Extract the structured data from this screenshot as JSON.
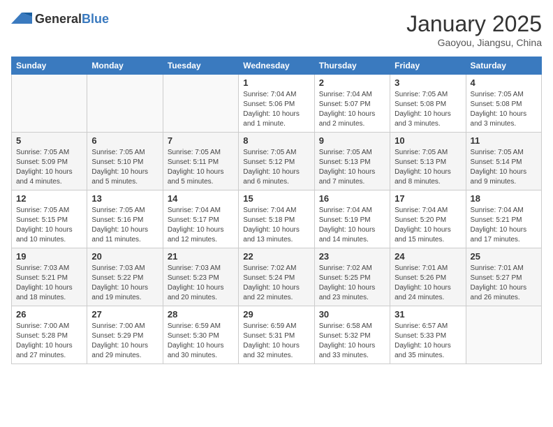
{
  "header": {
    "logo_general": "General",
    "logo_blue": "Blue",
    "title": "January 2025",
    "subtitle": "Gaoyou, Jiangsu, China"
  },
  "weekdays": [
    "Sunday",
    "Monday",
    "Tuesday",
    "Wednesday",
    "Thursday",
    "Friday",
    "Saturday"
  ],
  "weeks": [
    [
      {
        "day": "",
        "info": ""
      },
      {
        "day": "",
        "info": ""
      },
      {
        "day": "",
        "info": ""
      },
      {
        "day": "1",
        "info": "Sunrise: 7:04 AM\nSunset: 5:06 PM\nDaylight: 10 hours\nand 1 minute."
      },
      {
        "day": "2",
        "info": "Sunrise: 7:04 AM\nSunset: 5:07 PM\nDaylight: 10 hours\nand 2 minutes."
      },
      {
        "day": "3",
        "info": "Sunrise: 7:05 AM\nSunset: 5:08 PM\nDaylight: 10 hours\nand 3 minutes."
      },
      {
        "day": "4",
        "info": "Sunrise: 7:05 AM\nSunset: 5:08 PM\nDaylight: 10 hours\nand 3 minutes."
      }
    ],
    [
      {
        "day": "5",
        "info": "Sunrise: 7:05 AM\nSunset: 5:09 PM\nDaylight: 10 hours\nand 4 minutes."
      },
      {
        "day": "6",
        "info": "Sunrise: 7:05 AM\nSunset: 5:10 PM\nDaylight: 10 hours\nand 5 minutes."
      },
      {
        "day": "7",
        "info": "Sunrise: 7:05 AM\nSunset: 5:11 PM\nDaylight: 10 hours\nand 5 minutes."
      },
      {
        "day": "8",
        "info": "Sunrise: 7:05 AM\nSunset: 5:12 PM\nDaylight: 10 hours\nand 6 minutes."
      },
      {
        "day": "9",
        "info": "Sunrise: 7:05 AM\nSunset: 5:13 PM\nDaylight: 10 hours\nand 7 minutes."
      },
      {
        "day": "10",
        "info": "Sunrise: 7:05 AM\nSunset: 5:13 PM\nDaylight: 10 hours\nand 8 minutes."
      },
      {
        "day": "11",
        "info": "Sunrise: 7:05 AM\nSunset: 5:14 PM\nDaylight: 10 hours\nand 9 minutes."
      }
    ],
    [
      {
        "day": "12",
        "info": "Sunrise: 7:05 AM\nSunset: 5:15 PM\nDaylight: 10 hours\nand 10 minutes."
      },
      {
        "day": "13",
        "info": "Sunrise: 7:05 AM\nSunset: 5:16 PM\nDaylight: 10 hours\nand 11 minutes."
      },
      {
        "day": "14",
        "info": "Sunrise: 7:04 AM\nSunset: 5:17 PM\nDaylight: 10 hours\nand 12 minutes."
      },
      {
        "day": "15",
        "info": "Sunrise: 7:04 AM\nSunset: 5:18 PM\nDaylight: 10 hours\nand 13 minutes."
      },
      {
        "day": "16",
        "info": "Sunrise: 7:04 AM\nSunset: 5:19 PM\nDaylight: 10 hours\nand 14 minutes."
      },
      {
        "day": "17",
        "info": "Sunrise: 7:04 AM\nSunset: 5:20 PM\nDaylight: 10 hours\nand 15 minutes."
      },
      {
        "day": "18",
        "info": "Sunrise: 7:04 AM\nSunset: 5:21 PM\nDaylight: 10 hours\nand 17 minutes."
      }
    ],
    [
      {
        "day": "19",
        "info": "Sunrise: 7:03 AM\nSunset: 5:21 PM\nDaylight: 10 hours\nand 18 minutes."
      },
      {
        "day": "20",
        "info": "Sunrise: 7:03 AM\nSunset: 5:22 PM\nDaylight: 10 hours\nand 19 minutes."
      },
      {
        "day": "21",
        "info": "Sunrise: 7:03 AM\nSunset: 5:23 PM\nDaylight: 10 hours\nand 20 minutes."
      },
      {
        "day": "22",
        "info": "Sunrise: 7:02 AM\nSunset: 5:24 PM\nDaylight: 10 hours\nand 22 minutes."
      },
      {
        "day": "23",
        "info": "Sunrise: 7:02 AM\nSunset: 5:25 PM\nDaylight: 10 hours\nand 23 minutes."
      },
      {
        "day": "24",
        "info": "Sunrise: 7:01 AM\nSunset: 5:26 PM\nDaylight: 10 hours\nand 24 minutes."
      },
      {
        "day": "25",
        "info": "Sunrise: 7:01 AM\nSunset: 5:27 PM\nDaylight: 10 hours\nand 26 minutes."
      }
    ],
    [
      {
        "day": "26",
        "info": "Sunrise: 7:00 AM\nSunset: 5:28 PM\nDaylight: 10 hours\nand 27 minutes."
      },
      {
        "day": "27",
        "info": "Sunrise: 7:00 AM\nSunset: 5:29 PM\nDaylight: 10 hours\nand 29 minutes."
      },
      {
        "day": "28",
        "info": "Sunrise: 6:59 AM\nSunset: 5:30 PM\nDaylight: 10 hours\nand 30 minutes."
      },
      {
        "day": "29",
        "info": "Sunrise: 6:59 AM\nSunset: 5:31 PM\nDaylight: 10 hours\nand 32 minutes."
      },
      {
        "day": "30",
        "info": "Sunrise: 6:58 AM\nSunset: 5:32 PM\nDaylight: 10 hours\nand 33 minutes."
      },
      {
        "day": "31",
        "info": "Sunrise: 6:57 AM\nSunset: 5:33 PM\nDaylight: 10 hours\nand 35 minutes."
      },
      {
        "day": "",
        "info": ""
      }
    ]
  ]
}
